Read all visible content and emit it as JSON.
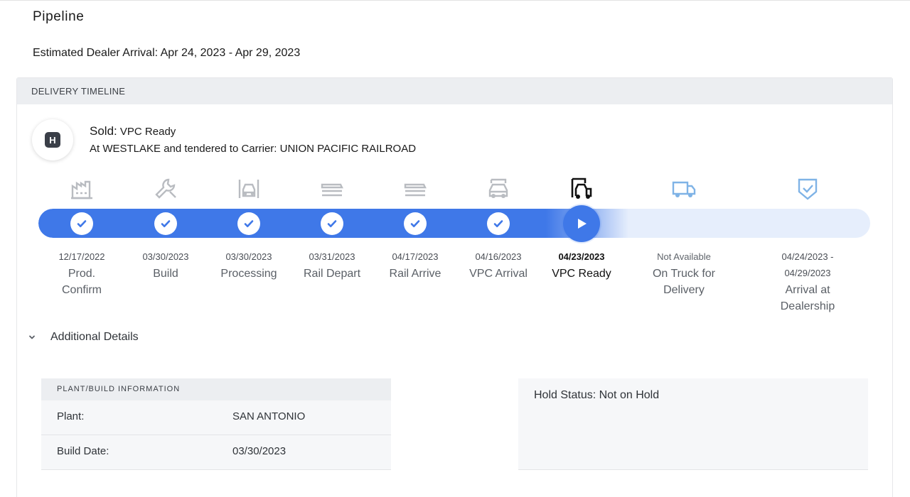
{
  "page_title": "Pipeline",
  "estimated_arrival": "Estimated Dealer Arrival: Apr 24, 2023 - Apr 29, 2023",
  "timeline": {
    "header": "DELIVERY TIMELINE",
    "badge_letter": "H",
    "status_prefix": "Sold:",
    "status_value": "VPC Ready",
    "status_detail": "At WESTLAKE and tendered to Carrier: UNION PACIFIC RAILROAD",
    "progress_completed_steps": 6,
    "current_step": 7,
    "steps": [
      {
        "date": "12/17/2022",
        "label": "Prod.\nConfirm",
        "icon": "factory-icon",
        "state": "complete"
      },
      {
        "date": "03/30/2023",
        "label": "Build",
        "icon": "wrench-icon",
        "state": "complete"
      },
      {
        "date": "03/30/2023",
        "label": "Processing",
        "icon": "car-front-icon",
        "state": "complete"
      },
      {
        "date": "03/31/2023",
        "label": "Rail Depart",
        "icon": "rail-car-icon",
        "state": "complete"
      },
      {
        "date": "04/17/2023",
        "label": "Rail Arrive",
        "icon": "rail-car-icon",
        "state": "complete"
      },
      {
        "date": "04/16/2023",
        "label": "VPC Arrival",
        "icon": "vpc-car-icon",
        "state": "complete"
      },
      {
        "date": "04/23/2023",
        "label": "VPC Ready",
        "icon": "vpc-ready-icon",
        "state": "current"
      },
      {
        "date": "Not Available",
        "label": "On Truck for\nDelivery",
        "icon": "truck-icon",
        "state": "upcoming"
      },
      {
        "date": "04/24/2023 -\n04/29/2023",
        "label": "Arrival at\nDealership",
        "icon": "shield-check-icon",
        "state": "upcoming"
      }
    ]
  },
  "additional_details": {
    "toggle_label": "Additional Details",
    "plant_panel": {
      "header": "PLANT/BUILD INFORMATION",
      "rows": [
        {
          "key": "Plant:",
          "value": "SAN ANTONIO"
        },
        {
          "key": "Build Date:",
          "value": "03/30/2023"
        }
      ]
    },
    "hold_status": "Hold Status: Not on Hold"
  },
  "colors": {
    "accent_blue": "#3f78e8",
    "track_light": "#e6eefc",
    "icon_done_gray": "#b9bcc1",
    "icon_upcoming_blue": "#7fb3e6",
    "icon_current": "#111111"
  }
}
